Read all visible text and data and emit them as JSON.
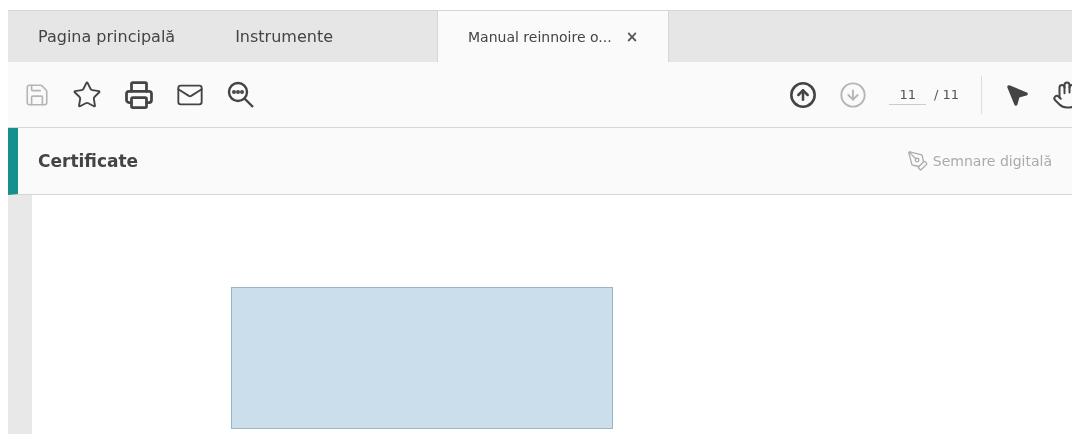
{
  "tabs": [
    {
      "label": "Pagina principală",
      "selected": false
    },
    {
      "label": "Instrumente",
      "selected": false
    },
    {
      "label": "Manual reinnoire o...",
      "selected": true,
      "close_label": "×"
    }
  ],
  "toolbar": {
    "save_disabled": true,
    "previous_disabled": false,
    "next_disabled": true,
    "page": "11",
    "page_total": "/ 11"
  },
  "panel": {
    "title": "Certificate",
    "action": "Semnare digitală",
    "action_disabled": true
  }
}
